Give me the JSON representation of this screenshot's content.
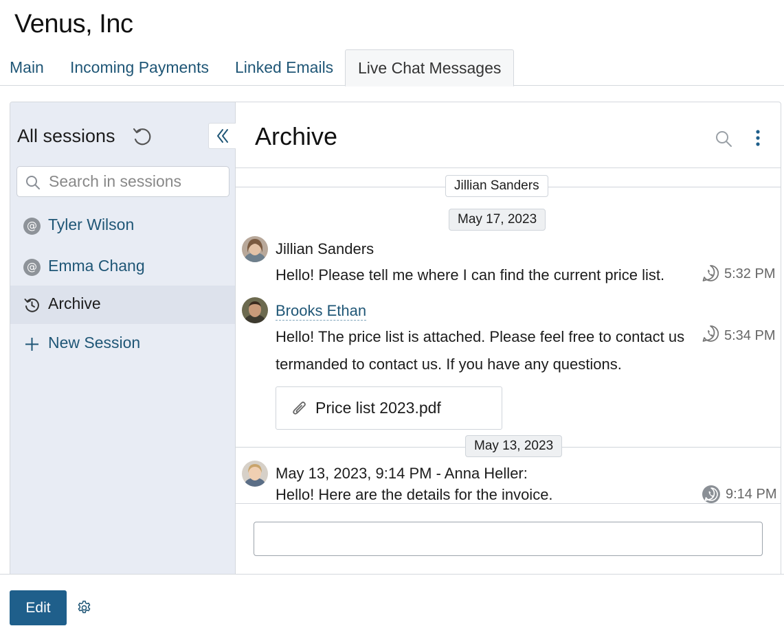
{
  "company": {
    "title": "Venus, Inc"
  },
  "tabs": [
    {
      "label": "Main",
      "active": false
    },
    {
      "label": "Incoming Payments",
      "active": false
    },
    {
      "label": "Linked Emails",
      "active": false
    },
    {
      "label": "Live Chat Messages",
      "active": true
    }
  ],
  "sidebar": {
    "title": "All sessions",
    "search_placeholder": "Search in sessions",
    "items": [
      {
        "label": "Tyler Wilson",
        "icon": "at-icon",
        "active": false
      },
      {
        "label": "Emma Chang",
        "icon": "at-icon",
        "active": false
      },
      {
        "label": "Archive",
        "icon": "history-icon",
        "active": true
      },
      {
        "label": "New Session",
        "icon": "plus-icon",
        "active": false
      }
    ]
  },
  "chat": {
    "title": "Archive",
    "session_label": "Jillian Sanders",
    "dates": [
      "May 17, 2023",
      "May 13, 2023"
    ],
    "messages": [
      {
        "author": "Jillian Sanders",
        "text": "Hello! Please tell me where I can find the current price list.",
        "time": "5:32 PM",
        "channel_icon": "whatsapp-icon"
      },
      {
        "author": "Brooks Ethan",
        "text_line1": "Hello! The price list is attached. Please feel free to contact us",
        "text_line2": "termanded to contact us. If you have any questions.",
        "time": "5:34 PM",
        "channel_icon": "whatsapp-icon",
        "attachment": "Price list 2023.pdf"
      },
      {
        "author": "May 13, 2023, 9:14 PM - Anna Heller:",
        "text": "Hello! Here are the details for the invoice.",
        "time": "9:14 PM",
        "channel_icon": "whatsapp-icon"
      }
    ]
  },
  "footer": {
    "edit_label": "Edit"
  },
  "colors": {
    "accent": "#1f5f8b",
    "link": "#1f5676",
    "sidebar_bg": "#e8ecf4"
  }
}
